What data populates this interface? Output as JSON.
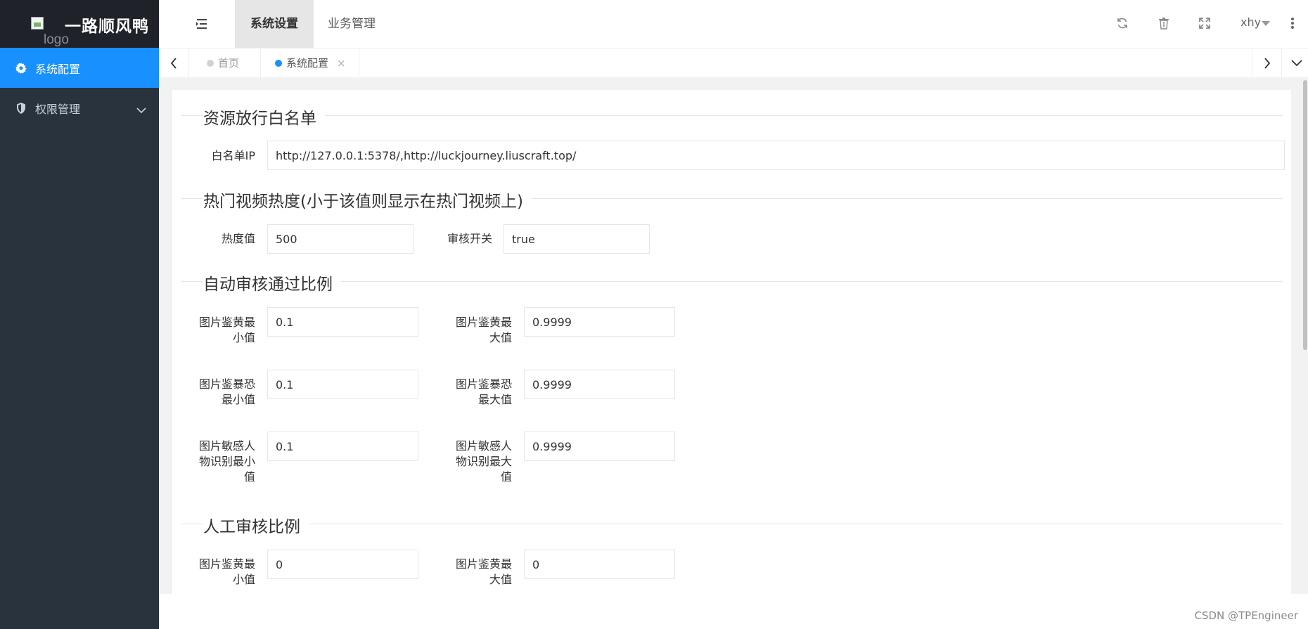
{
  "app": {
    "logo_alt": "logo",
    "title": "一路顺风鸭"
  },
  "sidebar": {
    "items": [
      {
        "label": "系统配置",
        "icon": "gear-icon"
      },
      {
        "label": "权限管理",
        "icon": "shield-icon"
      }
    ]
  },
  "header": {
    "tabs": [
      {
        "label": "系统设置"
      },
      {
        "label": "业务管理"
      }
    ],
    "user": "xhy",
    "icons": [
      "refresh-icon",
      "trash-icon",
      "fullscreen-icon",
      "more-icon"
    ]
  },
  "tabs_bar": {
    "tabs": [
      {
        "label": "首页"
      },
      {
        "label": "系统配置",
        "close": "×"
      }
    ]
  },
  "form": {
    "s1": {
      "title": "资源放行白名单",
      "ip_label": "白名单IP",
      "ip_value": "http://127.0.0.1:5378/,http://luckjourney.liuscraft.top/"
    },
    "s2": {
      "title": "热门视频热度(小于该值则显示在热门视频上)",
      "hot_label": "热度值",
      "hot_value": "500",
      "audit_label": "审核开关",
      "audit_value": "true"
    },
    "s3": {
      "title": "自动审核通过比例",
      "porn_min_label": "图片鉴黄最小值",
      "porn_min_value": "0.1",
      "porn_max_label": "图片鉴黄最大值",
      "porn_max_value": "0.9999",
      "terror_min_label": "图片鉴暴恐最小值",
      "terror_min_value": "0.1",
      "terror_max_label": "图片鉴暴恐最大值",
      "terror_max_value": "0.9999",
      "sensitive_min_label": "图片敏感人物识别最小值",
      "sensitive_min_value": "0.1",
      "sensitive_max_label": "图片敏感人物识别最大值",
      "sensitive_max_value": "0.9999"
    },
    "s4": {
      "title": "人工审核比例",
      "porn_min_label": "图片鉴黄最小值",
      "porn_min_value": "0",
      "porn_max_label": "图片鉴黄最大值",
      "porn_max_value": "0"
    }
  },
  "watermark": "CSDN @TPEngineer",
  "colors": {
    "sidebar_bg": "#28333e",
    "logo_bg": "#20222a",
    "accent": "#1890ff"
  }
}
